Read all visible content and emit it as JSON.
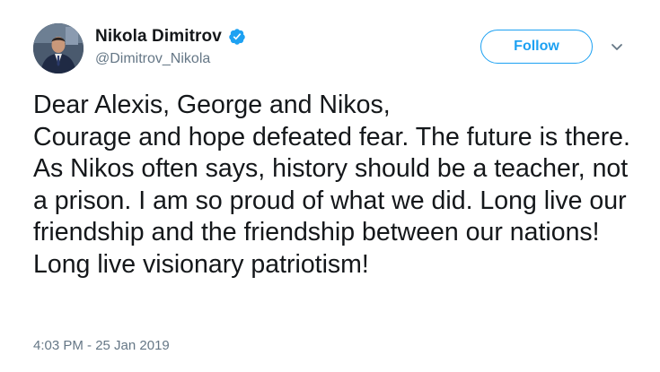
{
  "author": {
    "display_name": "Nikola Dimitrov",
    "handle": "@Dimitrov_Nikola",
    "verified": true,
    "avatar_icon": "profile-photo-icon"
  },
  "actions": {
    "follow_label": "Follow",
    "menu_icon": "chevron-down-icon"
  },
  "tweet": {
    "text": "Dear Alexis, George and Nikos,\nCourage and hope defeated fear. The future is there. As Nikos often says, history should be a teacher, not a prison. I am so proud of what we did. Long live our friendship and the friendship between our nations! Long live visionary patriotism!",
    "timestamp": "4:03 PM - 25 Jan 2019"
  },
  "colors": {
    "accent": "#1da1f2",
    "text_primary": "#14171a",
    "text_secondary": "#657786",
    "background": "#ffffff"
  }
}
